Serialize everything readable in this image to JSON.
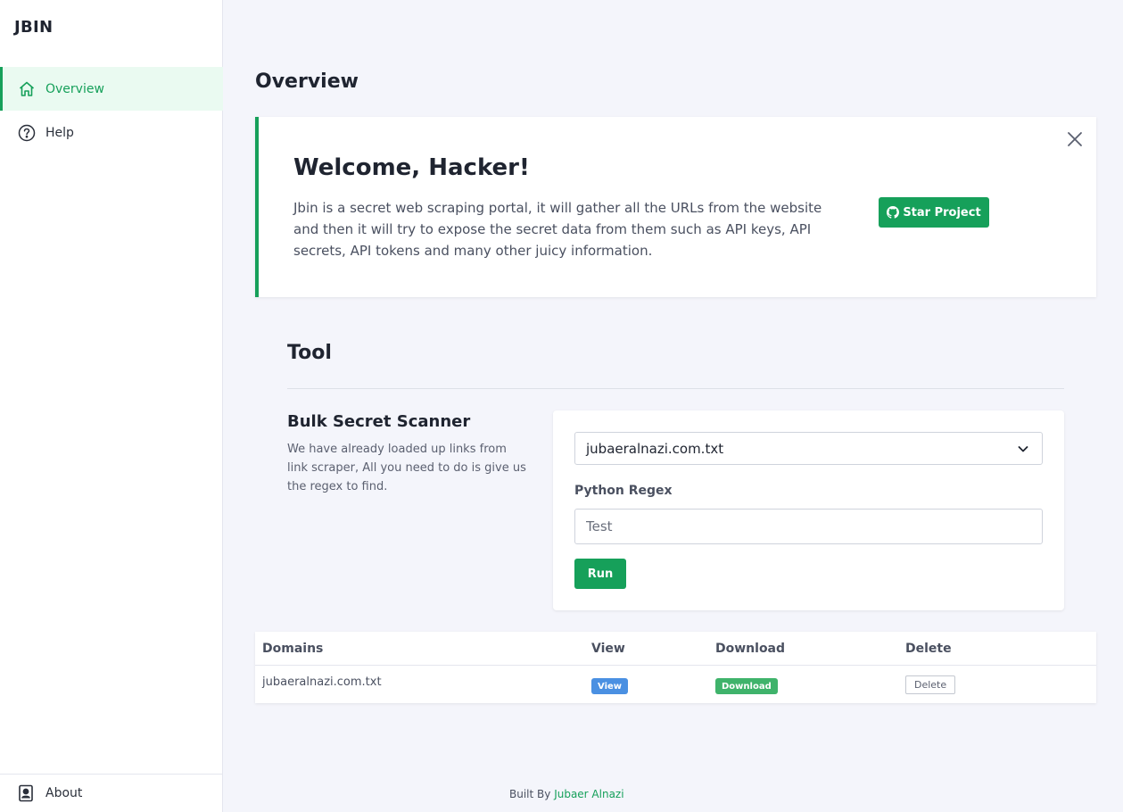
{
  "brand": "JBIN",
  "sidebar": {
    "items": [
      {
        "label": "Overview",
        "icon": "home-icon",
        "active": true
      },
      {
        "label": "Help",
        "icon": "question-circle-icon",
        "active": false
      }
    ],
    "footer": {
      "label": "About",
      "icon": "contact-card-icon"
    }
  },
  "page": {
    "title": "Overview"
  },
  "welcome": {
    "title": "Welcome, Hacker!",
    "text": "Jbin is a secret web scraping portal, it will gather all the URLs from the website and then it will try to expose the secret data from them such as API keys, API secrets, API tokens and many other juicy information.",
    "button_label": "Star Project",
    "button_icon": "github-icon",
    "close_icon": "close-icon"
  },
  "tool": {
    "title": "Tool",
    "scanner": {
      "title": "Bulk Secret Scanner",
      "description": "We have already loaded up links from link scraper, All you need to do is give us the regex to find."
    },
    "form": {
      "selected_file": "jubaeralnazi.com.txt",
      "regex_label": "Python Regex",
      "regex_placeholder": "Test",
      "run_label": "Run"
    }
  },
  "table": {
    "headers": [
      "Domains",
      "View",
      "Download",
      "Delete"
    ],
    "rows": [
      {
        "domain": "jubaeralnazi.com.txt",
        "view": "View",
        "download": "Download",
        "delete": "Delete"
      }
    ]
  },
  "footer": {
    "prefix": "Built By",
    "author": "Jubaer Alnazi"
  },
  "colors": {
    "accent": "#16a05a",
    "view_badge": "#4a90e2",
    "download_badge": "#3fb36b",
    "background": "#f4f5fb"
  }
}
